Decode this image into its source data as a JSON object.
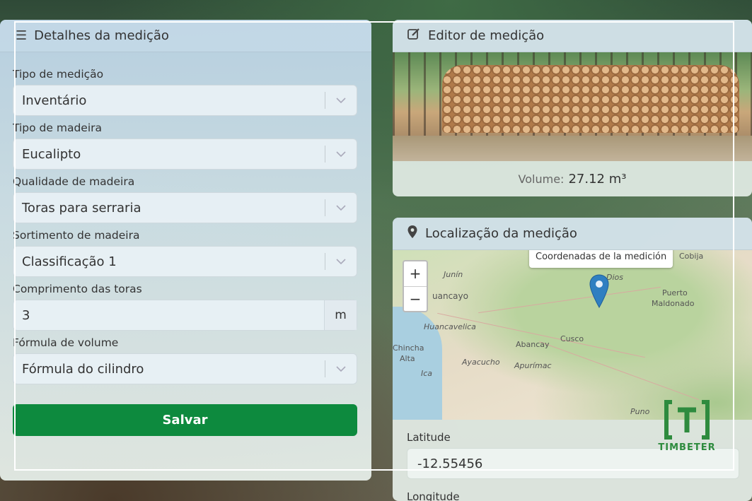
{
  "details": {
    "title": "Detalhes da medição",
    "fields": [
      {
        "label": "Tipo de medição",
        "value": "Inventário"
      },
      {
        "label": "Tipo de madeira",
        "value": "Eucalipto"
      },
      {
        "label": "Qualidade de madeira",
        "value": "Toras para serraria"
      },
      {
        "label": "Sortimento de madeira",
        "value": "Classificação 1"
      }
    ],
    "length": {
      "label": "Comprimento das toras",
      "value": "3",
      "unit": "m"
    },
    "formula": {
      "label": "Fórmula de volume",
      "value": "Fórmula do cilindro"
    },
    "save_label": "Salvar"
  },
  "editor": {
    "title": "Editor de medição",
    "volume_label": "Volume:",
    "volume_value": "27.12 m³"
  },
  "location": {
    "title": "Localização da medição",
    "tooltip": "Coordenadas de la medición",
    "zoom_in": "+",
    "zoom_out": "−",
    "map_labels": {
      "junin": "Junín",
      "huancayo": "uancayo",
      "huancavelica": "Huancavelica",
      "chincha": "Chincha",
      "alta": "Alta",
      "ica": "Ica",
      "ayacucho": "Ayacucho",
      "abancay": "Abancay",
      "cusco": "Cusco",
      "apurimac": "Apurímac",
      "puno": "Puno",
      "cobija": "Cobija",
      "puerto": "Puerto",
      "maldonado": "Maldonado",
      "dios": "Dios"
    },
    "latitude_label": "Latitude",
    "latitude_value": "-12.55456",
    "longitude_label": "Longitude"
  },
  "brand": {
    "name": "TIMBETER",
    "color": "#2e8b3e"
  },
  "colors": {
    "primary": "#0d8a3e",
    "pin": "#2f7fc1"
  }
}
